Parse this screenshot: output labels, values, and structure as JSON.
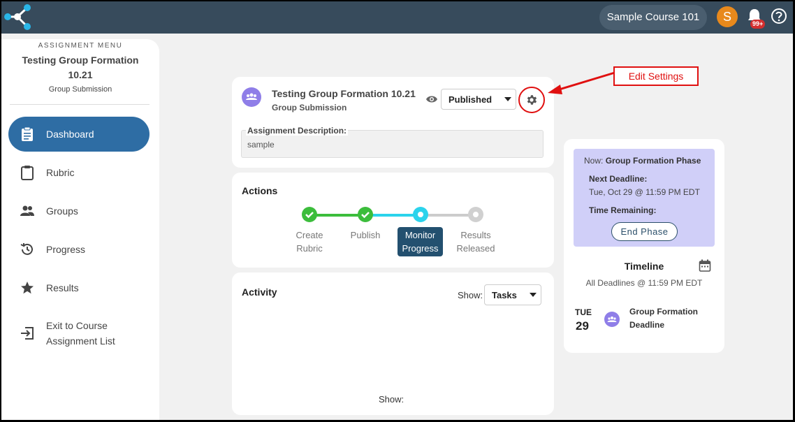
{
  "topbar": {
    "course": "Sample Course 101",
    "avatar_initial": "S",
    "notif_badge": "99+"
  },
  "sidebar": {
    "caption": "ASSIGNMENT MENU",
    "title": "Testing Group Formation 10.21",
    "subtitle": "Group Submission",
    "items": [
      {
        "label": "Dashboard",
        "icon": "clipboard-icon",
        "active": true
      },
      {
        "label": "Rubric",
        "icon": "clipboard-outline-icon"
      },
      {
        "label": "Groups",
        "icon": "people-icon"
      },
      {
        "label": "Progress",
        "icon": "history-icon"
      },
      {
        "label": "Results",
        "icon": "star-icon"
      },
      {
        "label_line1": "Exit to Course",
        "label_line2": "Assignment List",
        "icon": "exit-icon"
      }
    ]
  },
  "header": {
    "title": "Testing Group Formation 10.21",
    "subtitle": "Group Submission",
    "status": "Published",
    "desc_label": "Assignment Description:",
    "desc_text": "sample"
  },
  "actions": {
    "title": "Actions",
    "steps": [
      {
        "line1": "Create",
        "line2": "Rubric",
        "state": "done"
      },
      {
        "line1": "Publish",
        "line2": "",
        "state": "done"
      },
      {
        "line1": "Monitor",
        "line2": "Progress",
        "state": "current"
      },
      {
        "line1": "Results",
        "line2": "Released",
        "state": "pending"
      }
    ]
  },
  "activity": {
    "title": "Activity",
    "show_label": "Show:",
    "filter": "Tasks",
    "footer_show": "Show:"
  },
  "phase": {
    "now_label": "Now:",
    "now_value": "Group Formation Phase",
    "deadline_label": "Next Deadline:",
    "deadline_value": "Tue, Oct 29 @ 11:59 PM EDT",
    "remaining_label": "Time Remaining:",
    "end_button": "End Phase"
  },
  "timeline": {
    "title": "Timeline",
    "subtitle": "All Deadlines @ 11:59 PM EDT",
    "event": {
      "day": "TUE",
      "date": "29",
      "line1": "Group Formation",
      "line2": "Deadline"
    }
  },
  "annotation": {
    "callout": "Edit Settings"
  },
  "colors": {
    "topbar": "#374b5c",
    "active_nav": "#2e6da4",
    "done": "#3cbd3c",
    "current": "#2bd3ec",
    "phase_bg": "#d0cff8",
    "callout_red": "#e01010"
  }
}
